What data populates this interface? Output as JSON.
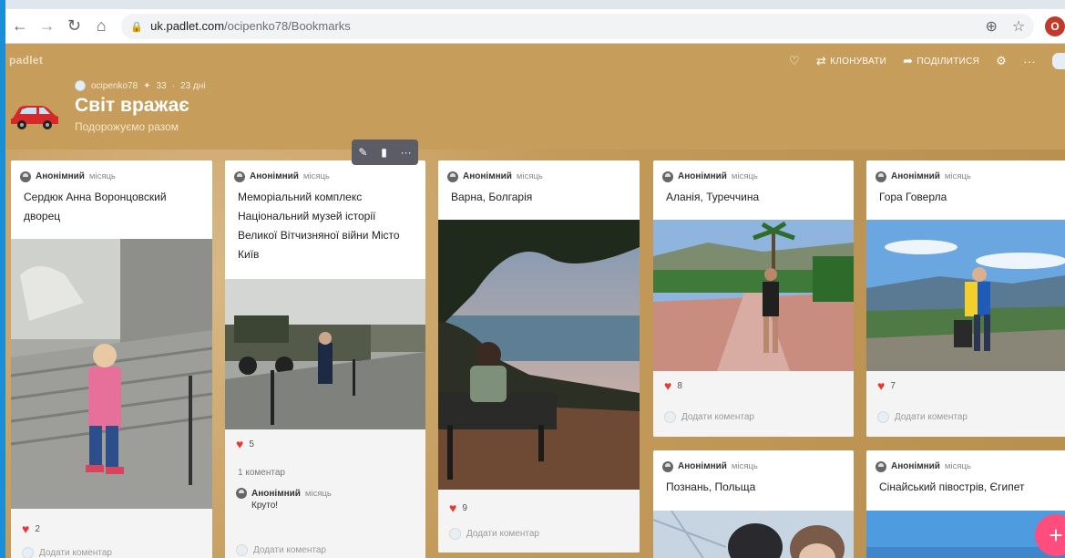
{
  "browser": {
    "url_domain": "uk.padlet.com",
    "url_path": "/ocipenko78/Bookmarks",
    "profile_initial": "O"
  },
  "padlet": {
    "logo": "padlet",
    "like_label": "",
    "clone_label": "КЛОНУВАТИ",
    "share_label": "ПОДІЛИТИСЯ",
    "owner": "ocipenko78",
    "likes": "33",
    "age": "23 дні",
    "title": "Світ вражає",
    "subtitle": "Подорожуємо разом"
  },
  "colors": {
    "header": "#c69d5a",
    "heart": "#e53935",
    "fab": "#ff4d7d"
  },
  "add_comment_label": "Додати коментар",
  "cards": [
    {
      "author": "Анонімний",
      "when": "місяць",
      "title": "Сердюк Анна Воронцовский дворец",
      "likes": "2"
    },
    {
      "author": "Анонімний",
      "when": "місяць",
      "title": "Меморіальний комплекс Національний музей історії Великої Вітчизняної війни Місто Київ",
      "likes": "5",
      "comment_count": "1 коментар",
      "comment_author": "Анонімний",
      "comment_when": "місяць",
      "comment_text": "Круто!"
    },
    {
      "author": "Анонімний",
      "when": "місяць",
      "title": "Варна, Болгарія",
      "likes": "9"
    },
    {
      "author": "Анонімний",
      "when": "місяць",
      "title": "Аланія, Туреччина",
      "likes": "8"
    },
    {
      "author": "Анонімний",
      "when": "місяць",
      "title": "Гора Говерла",
      "likes": "7"
    },
    {
      "author": "Анонімний",
      "when": "місяць",
      "title": "Познань, Польща"
    },
    {
      "author": "Анонімний",
      "when": "місяць",
      "title": "Сінайський півострів, Єгипет"
    }
  ]
}
